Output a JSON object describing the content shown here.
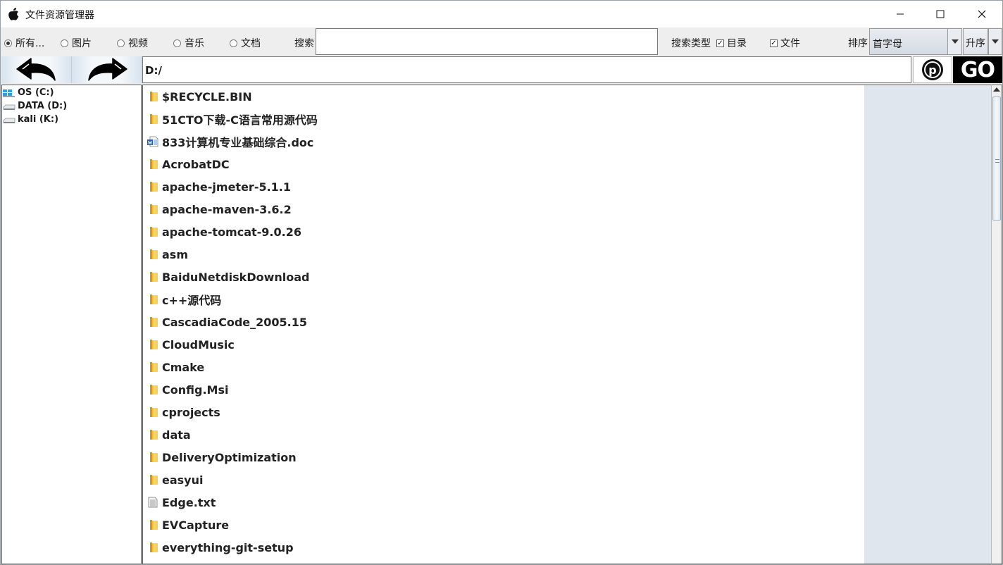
{
  "window": {
    "title": "文件资源管理器"
  },
  "toolbar": {
    "filters": [
      {
        "label": "所有...",
        "checked": true
      },
      {
        "label": "图片",
        "checked": false
      },
      {
        "label": "视频",
        "checked": false
      },
      {
        "label": "音乐",
        "checked": false
      },
      {
        "label": "文档",
        "checked": false
      }
    ],
    "search_label": "搜索",
    "search_value": "",
    "search_type_label": "搜索类型",
    "dir_checkbox": {
      "label": "目录",
      "checked": true
    },
    "file_checkbox": {
      "label": "文件",
      "checked": true
    },
    "sort_label": "排序",
    "sort_value": "首字母",
    "order_label": "升序"
  },
  "nav": {
    "path": "D:/",
    "go_label": "GO",
    "p_label": "p"
  },
  "drives": [
    {
      "label": "OS (C:)",
      "icon": "windows-drive-icon"
    },
    {
      "label": "DATA (D:)",
      "icon": "drive-icon"
    },
    {
      "label": "kali (K:)",
      "icon": "drive-icon"
    }
  ],
  "files": [
    {
      "name": "$RECYCLE.BIN",
      "type": "folder"
    },
    {
      "name": "51CTO下载-C语言常用源代码",
      "type": "folder"
    },
    {
      "name": "833计算机专业基础综合.doc",
      "type": "doc"
    },
    {
      "name": "AcrobatDC",
      "type": "folder"
    },
    {
      "name": "apache-jmeter-5.1.1",
      "type": "folder"
    },
    {
      "name": "apache-maven-3.6.2",
      "type": "folder"
    },
    {
      "name": "apache-tomcat-9.0.26",
      "type": "folder"
    },
    {
      "name": "asm",
      "type": "folder"
    },
    {
      "name": "BaiduNetdiskDownload",
      "type": "folder"
    },
    {
      "name": "c++源代码",
      "type": "folder"
    },
    {
      "name": "CascadiaCode_2005.15",
      "type": "folder"
    },
    {
      "name": "CloudMusic",
      "type": "folder"
    },
    {
      "name": "Cmake",
      "type": "folder"
    },
    {
      "name": "Config.Msi",
      "type": "folder"
    },
    {
      "name": "cprojects",
      "type": "folder"
    },
    {
      "name": "data",
      "type": "folder"
    },
    {
      "name": "DeliveryOptimization",
      "type": "folder"
    },
    {
      "name": "easyui",
      "type": "folder"
    },
    {
      "name": "Edge.txt",
      "type": "txt"
    },
    {
      "name": "EVCapture",
      "type": "folder"
    },
    {
      "name": "everything-git-setup",
      "type": "folder"
    }
  ]
}
